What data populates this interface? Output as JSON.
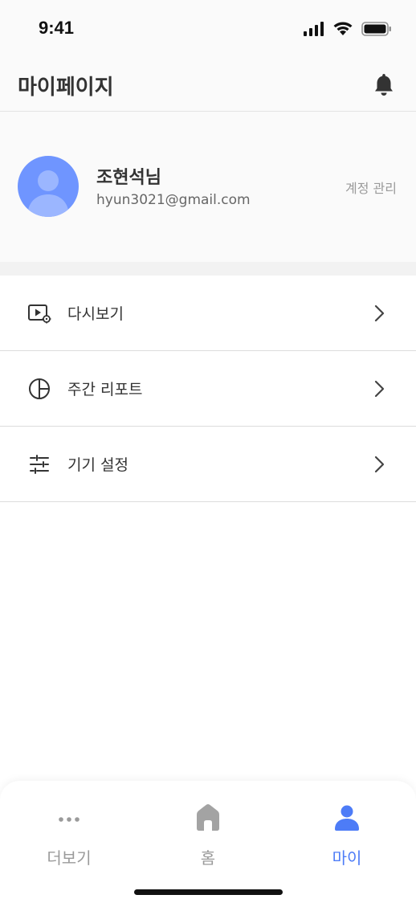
{
  "status_bar": {
    "time": "9:41"
  },
  "header": {
    "title": "마이페이지"
  },
  "profile": {
    "name": "조현석님",
    "email": "hyun3021@gmail.com",
    "account_manage_label": "계정 관리"
  },
  "menu": {
    "items": [
      {
        "label": "다시보기",
        "icon": "replay-video-icon"
      },
      {
        "label": "주간 리포트",
        "icon": "pie-chart-icon"
      },
      {
        "label": "기기 설정",
        "icon": "sliders-icon"
      }
    ]
  },
  "tabbar": {
    "tabs": [
      {
        "label": "더보기",
        "icon": "more-dots-icon",
        "active": false
      },
      {
        "label": "홈",
        "icon": "home-icon",
        "active": false
      },
      {
        "label": "마이",
        "icon": "person-icon",
        "active": true
      }
    ],
    "active_color": "#4d7cf7",
    "inactive_color": "#9a9a9a"
  },
  "colors": {
    "accent": "#4d7cf7",
    "avatar_bg": "#6f95ff"
  }
}
